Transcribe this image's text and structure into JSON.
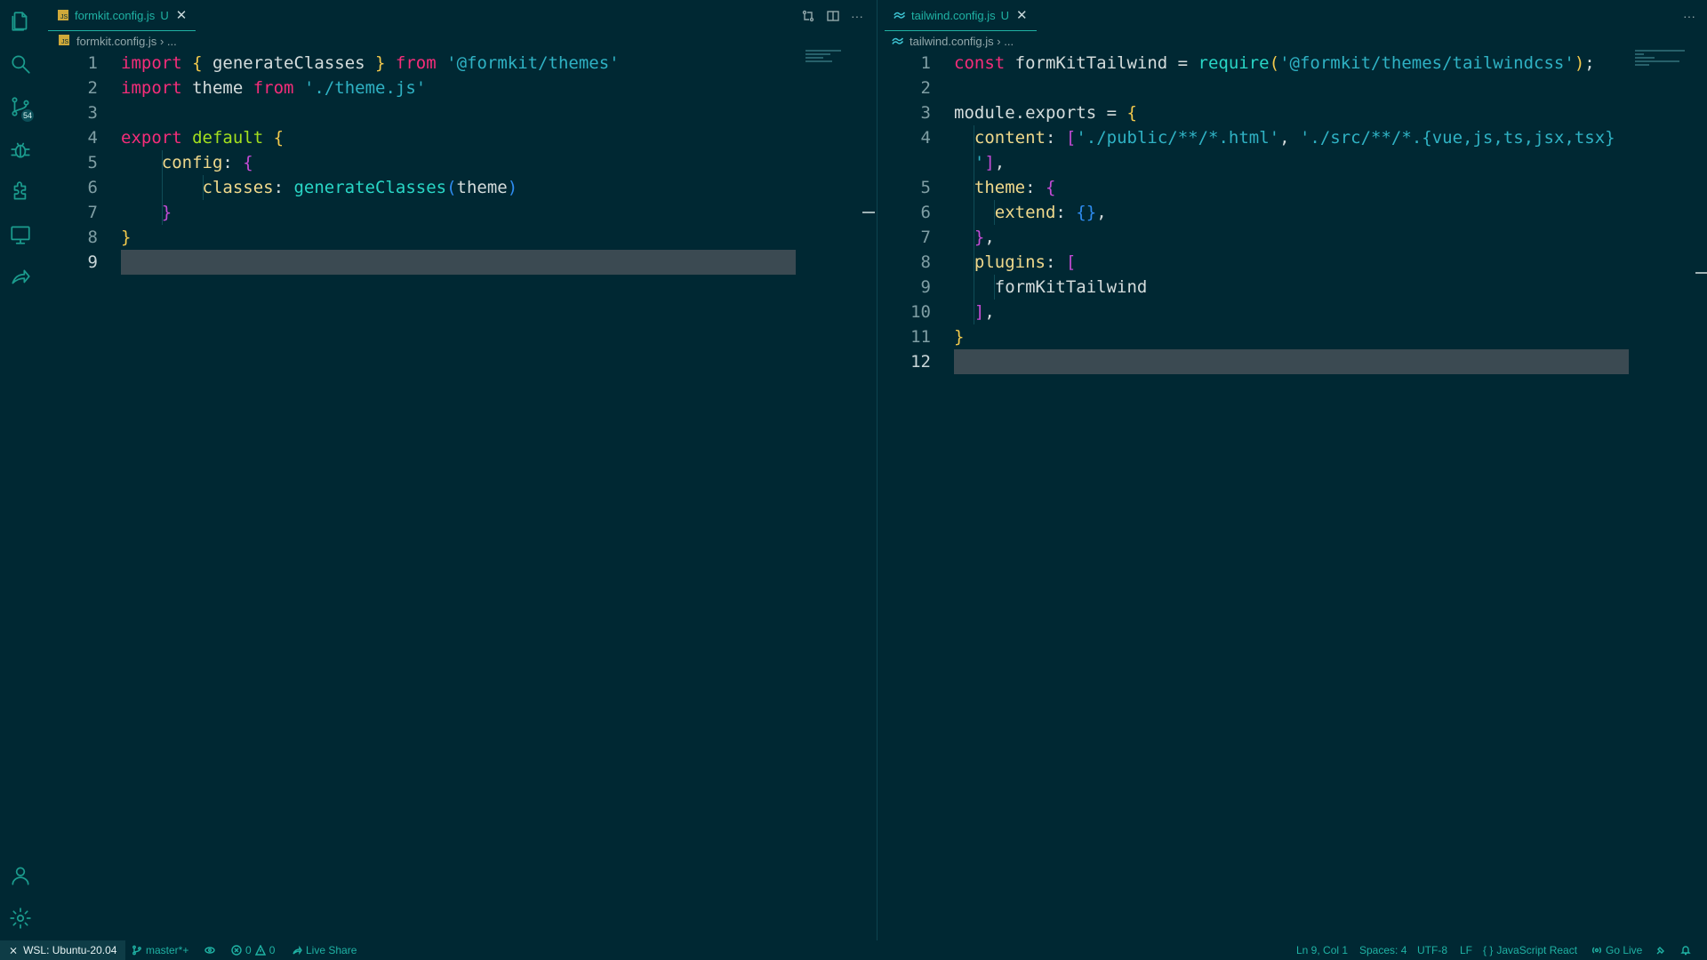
{
  "activity_bar": {
    "icons": [
      "explorer-icon",
      "search-icon",
      "source-control-icon",
      "debug-icon",
      "extensions-icon",
      "remote-explorer-icon",
      "live-share-icon",
      "account-icon",
      "settings-gear-icon"
    ],
    "source_control_badge": "54"
  },
  "left_editor": {
    "tab": {
      "filename": "formkit.config.js",
      "flag": "U",
      "close": "✕"
    },
    "breadcrumb": {
      "file": "formkit.config.js",
      "rest": "› ..."
    },
    "actions": [
      "compare-changes-icon",
      "split-editor-icon",
      "more-actions-icon"
    ],
    "line_numbers": [
      "1",
      "2",
      "3",
      "4",
      "5",
      "6",
      "7",
      "8",
      "9"
    ],
    "lines": [
      [
        [
          "kw",
          "import"
        ],
        [
          "t",
          " "
        ],
        [
          "br1",
          "{"
        ],
        [
          "t",
          " generateClasses "
        ],
        [
          "br1",
          "}"
        ],
        [
          "t",
          " "
        ],
        [
          "kw",
          "from"
        ],
        [
          "t",
          " "
        ],
        [
          "str",
          "'@formkit/themes'"
        ]
      ],
      [
        [
          "kw",
          "import"
        ],
        [
          "t",
          " theme "
        ],
        [
          "kw",
          "from"
        ],
        [
          "t",
          " "
        ],
        [
          "str",
          "'./theme.js'"
        ]
      ],
      [],
      [
        [
          "kw",
          "export"
        ],
        [
          "t",
          " "
        ],
        [
          "kw2",
          "default"
        ],
        [
          "t",
          " "
        ],
        [
          "br1",
          "{"
        ]
      ],
      [
        [
          "t",
          "    "
        ],
        [
          "prop",
          "config"
        ],
        [
          "t",
          ": "
        ],
        [
          "br2",
          "{"
        ]
      ],
      [
        [
          "t",
          "        "
        ],
        [
          "prop",
          "classes"
        ],
        [
          "t",
          ": "
        ],
        [
          "fn",
          "generateClasses"
        ],
        [
          "br3",
          "("
        ],
        [
          "t",
          "theme"
        ],
        [
          "br3",
          ")"
        ]
      ],
      [
        [
          "t",
          "    "
        ],
        [
          "br2",
          "}"
        ]
      ],
      [
        [
          "br1",
          "}"
        ]
      ],
      []
    ]
  },
  "right_editor": {
    "tab": {
      "filename": "tailwind.config.js",
      "flag": "U",
      "close": "✕"
    },
    "breadcrumb": {
      "file": "tailwind.config.js",
      "rest": "› ..."
    },
    "actions": [
      "more-actions-icon"
    ],
    "line_numbers": [
      "1",
      "2",
      "3",
      "4",
      "",
      "5",
      "6",
      "7",
      "8",
      "9",
      "10",
      "11",
      "12"
    ],
    "lines": [
      [
        [
          "kw",
          "const"
        ],
        [
          "t",
          " formKitTailwind = "
        ],
        [
          "fn",
          "require"
        ],
        [
          "br1",
          "("
        ],
        [
          "str",
          "'@formkit/themes/tailwindcss'"
        ],
        [
          "br1",
          ")"
        ],
        [
          "t",
          ";"
        ]
      ],
      [],
      [
        [
          "t",
          "module.exports = "
        ],
        [
          "br1",
          "{"
        ]
      ],
      [
        [
          "t",
          "  "
        ],
        [
          "prop",
          "content"
        ],
        [
          "t",
          ": "
        ],
        [
          "br2",
          "["
        ],
        [
          "str",
          "'./public/**/*.html'"
        ],
        [
          "t",
          ", "
        ],
        [
          "str",
          "'./src/**/*.{vue,js,ts,jsx,tsx}"
        ]
      ],
      [
        [
          "t",
          "  "
        ],
        [
          "str",
          "'"
        ],
        [
          "br2",
          "]"
        ],
        [
          "t",
          ","
        ]
      ],
      [
        [
          "t",
          "  "
        ],
        [
          "prop",
          "theme"
        ],
        [
          "t",
          ": "
        ],
        [
          "br2",
          "{"
        ]
      ],
      [
        [
          "t",
          "    "
        ],
        [
          "prop",
          "extend"
        ],
        [
          "t",
          ": "
        ],
        [
          "br3",
          "{}"
        ],
        [
          "t",
          ","
        ]
      ],
      [
        [
          "t",
          "  "
        ],
        [
          "br2",
          "}"
        ],
        [
          "t",
          ","
        ]
      ],
      [
        [
          "t",
          "  "
        ],
        [
          "prop",
          "plugins"
        ],
        [
          "t",
          ": "
        ],
        [
          "br2",
          "["
        ]
      ],
      [
        [
          "t",
          "    formKitTailwind"
        ]
      ],
      [
        [
          "t",
          "  "
        ],
        [
          "br2",
          "]"
        ],
        [
          "t",
          ","
        ]
      ],
      [
        [
          "br1",
          "}"
        ]
      ],
      []
    ]
  },
  "status_bar": {
    "remote": "WSL: Ubuntu-20.04",
    "branch": "master*+",
    "errors": "0",
    "warnings": "0",
    "live_share": "Live Share",
    "cursor": "Ln 9, Col 1",
    "spaces": "Spaces: 4",
    "encoding": "UTF-8",
    "eol": "LF",
    "language": "JavaScript React",
    "go_live": "Go Live"
  }
}
